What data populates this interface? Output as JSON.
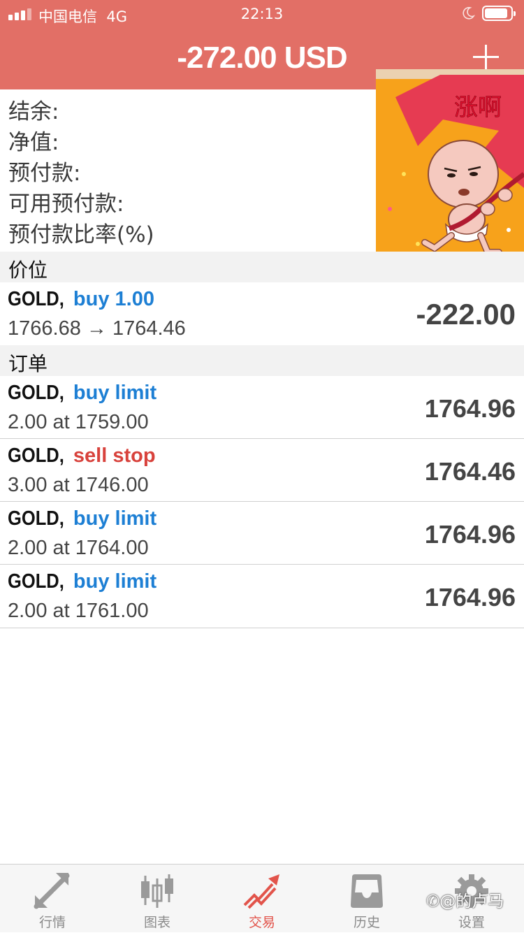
{
  "status_bar": {
    "carrier": "中国电信",
    "network": "4G",
    "time": "22:13"
  },
  "header": {
    "balance_title": "-272.00 USD",
    "add_icon": "plus-icon"
  },
  "summary": {
    "labels": [
      "结余:",
      "净值:",
      "预付款:",
      "可用预付款:",
      "预付款比率(%)"
    ]
  },
  "sticker": {
    "text": "涨啊"
  },
  "positions": {
    "section_title": "价位",
    "items": [
      {
        "symbol": "GOLD,",
        "action": "buy 1.00",
        "action_color": "#1d7fd4",
        "prices": "1766.68 → 1764.46",
        "profit": "-222.00",
        "profit_color": "#d8423c"
      }
    ]
  },
  "orders": {
    "section_title": "订单",
    "items": [
      {
        "symbol": "GOLD,",
        "action": "buy limit",
        "action_color": "#1d7fd4",
        "detail": "2.00 at 1759.00",
        "price": "1764.96"
      },
      {
        "symbol": "GOLD,",
        "action": "sell stop",
        "action_color": "#d8423c",
        "detail": "3.00 at 1746.00",
        "price": "1764.46"
      },
      {
        "symbol": "GOLD,",
        "action": "buy limit",
        "action_color": "#1d7fd4",
        "detail": "2.00 at 1764.00",
        "price": "1764.96"
      },
      {
        "symbol": "GOLD,",
        "action": "buy limit",
        "action_color": "#1d7fd4",
        "detail": "2.00 at 1761.00",
        "price": "1764.96"
      }
    ]
  },
  "tabbar": {
    "tabs": [
      {
        "label": "行情",
        "icon": "quotes-arrows-icon"
      },
      {
        "label": "图表",
        "icon": "candlestick-chart-icon"
      },
      {
        "label": "交易",
        "icon": "trade-trend-icon",
        "active": true
      },
      {
        "label": "历史",
        "icon": "history-inbox-icon"
      },
      {
        "label": "设置",
        "icon": "gear-icon"
      }
    ]
  },
  "watermark": "@的卢马",
  "colors": {
    "header_bg": "#e26f66",
    "blue": "#1d7fd4",
    "red": "#d8423c",
    "active_tab": "#e2544b"
  }
}
